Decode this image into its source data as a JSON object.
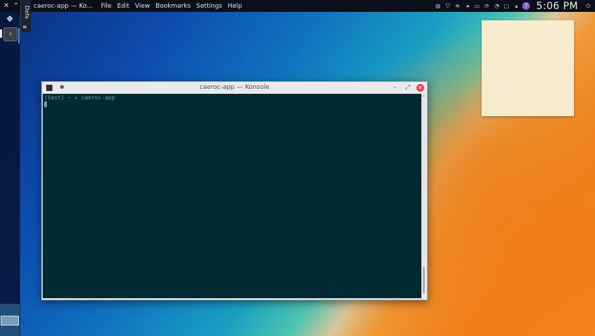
{
  "top_panel": {
    "app_title": "caeroc-app — Ko...",
    "menu": [
      "File",
      "Edit",
      "View",
      "Bookmarks",
      "Settings",
      "Help"
    ],
    "clock": "5:06 PM",
    "icons": [
      "close-icon",
      "chevron-up-icon",
      "app-icon",
      "network-icon",
      "shield-icon",
      "wifi-icon",
      "volume-icon",
      "battery-icon",
      "updates-icon",
      "notifications-icon",
      "display-icon",
      "arrow-up-icon",
      "help-icon",
      "power-icon"
    ]
  },
  "left_panel": {
    "default_tab_label": "Defa",
    "default_tab_menu_glyph": "≡",
    "launcher_glyph": "❖",
    "terminal_glyph": "›"
  },
  "konsole": {
    "title": "caeroc-app — Konsole",
    "prompt_env": "(test)",
    "prompt_path": "~",
    "prompt_symbol": "»",
    "command": "caeroc-app"
  },
  "colors": {
    "terminal_bg": "#022a33",
    "close_button": "#e9434e",
    "note_bg": "#f6eccd",
    "panel_bg": "#0b0f1a"
  }
}
